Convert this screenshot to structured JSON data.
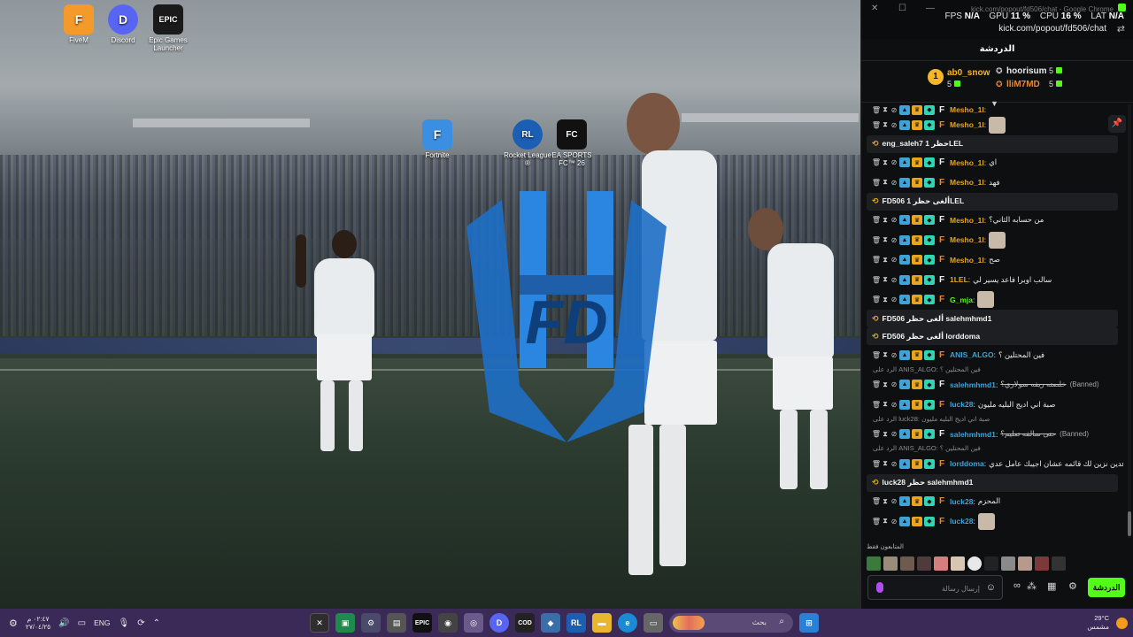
{
  "desktop": {
    "icons": [
      {
        "label": "FiveM",
        "color": "#f39a2a",
        "glyph": "F"
      },
      {
        "label": "Discord",
        "color": "#5865f2",
        "glyph": "D"
      },
      {
        "label": "Epic Games Launcher",
        "color": "#1a1a1a",
        "glyph": "EPIC"
      },
      {
        "label": "Fortnite",
        "color": "#3b8fe2",
        "glyph": "F"
      },
      {
        "label": "Rocket League ®",
        "color": "#1a5fb4",
        "glyph": "RL"
      },
      {
        "label": "EA SPORTS FC™ 26",
        "color": "#111111",
        "glyph": "FC"
      }
    ],
    "wallpaper_logo_text": "FD"
  },
  "chat_window": {
    "title": "kick.com/popout/fd506/chat - Google Chrome",
    "url": "kick.com/popout/fd506/chat",
    "overlay": {
      "fps_label": "FPS",
      "fps": "N/A",
      "gpu_label": "GPU",
      "gpu": "11 %",
      "cpu_label": "CPU",
      "cpu": "16 %",
      "lat_label": "LAT",
      "lat": "N/A"
    },
    "header": "الدردشة",
    "leaderboard": {
      "rank": "1",
      "first": {
        "name": "ab0_snow",
        "count": "5"
      },
      "second": {
        "name": "hoorisum",
        "count": "5"
      },
      "third": {
        "name": "lliM7MD",
        "count": "5"
      }
    },
    "messages": [
      {
        "kind": "msg",
        "user": "Mesho_1l",
        "color": "#e9a51c",
        "text": "",
        "cut": true
      },
      {
        "kind": "msg",
        "user": "Mesho_1l",
        "color": "#e9a51c",
        "text": "",
        "avatar": true
      },
      {
        "kind": "sys",
        "text": "eng_saleh7 حظر 1LEL"
      },
      {
        "kind": "msg",
        "user": "Mesho_1l",
        "color": "#e9a51c",
        "text": "اي"
      },
      {
        "kind": "msg",
        "user": "Mesho_1l",
        "color": "#e9a51c",
        "text": "فهد"
      },
      {
        "kind": "sys",
        "text": "FD506 ألغى حظر 1LEL"
      },
      {
        "kind": "msg",
        "user": "Mesho_1l",
        "color": "#e9a51c",
        "text": "من حسابه الثاني؟"
      },
      {
        "kind": "msg",
        "user": "Mesho_1l",
        "color": "#e9a51c",
        "text": "",
        "avatar": true
      },
      {
        "kind": "msg",
        "user": "Mesho_1l",
        "color": "#e9a51c",
        "text": "صح"
      },
      {
        "kind": "msg",
        "user": "1LEL",
        "color": "#e9a51c",
        "text": "سالب اوبرا فاعد يسير لي"
      },
      {
        "kind": "msg",
        "user": "G_mja",
        "color": "#53fc18",
        "text": "",
        "avatar": true
      },
      {
        "kind": "sys",
        "text": "FD506 ألغى حظر salehmhmd1"
      },
      {
        "kind": "sys",
        "text": "FD506 ألغى حظر lorddoma"
      },
      {
        "kind": "msg",
        "user": "ANIS_ALGO",
        "color": "#3ea3d6",
        "text": "فين المحتلين ؟"
      },
      {
        "kind": "reply",
        "text": "الرد على ANIS_ALGO: فين المحتلين ؟"
      },
      {
        "kind": "msg",
        "user": "salehmhmd1",
        "color": "#3ea3d6",
        "text": "خلصته ريفه سولاري؟",
        "banned": "(Banned)"
      },
      {
        "kind": "msg",
        "user": "luck28",
        "color": "#3ea3d6",
        "text": "صبة اني اديج البليه مليون"
      },
      {
        "kind": "reply",
        "text": "الرد على luck28: صبة اني اديج البليه مليون"
      },
      {
        "kind": "msg",
        "user": "salehmhmd1",
        "color": "#3ea3d6",
        "text": "حتى سالفه تعليم؟",
        "banned": "(Banned)"
      },
      {
        "kind": "reply",
        "text": "الرد على ANIS_ALGO: فين المحتلين ؟"
      },
      {
        "kind": "msg",
        "user": "lorddoma",
        "color": "#3ea3d6",
        "text": "فاعدين نزين لك قائمه عشان اجيبك عامل عدي"
      },
      {
        "kind": "sys",
        "text": "luck28 حظر salehmhmd1"
      },
      {
        "kind": "msg",
        "user": "luck28",
        "color": "#3ea3d6",
        "text": "المحزم"
      },
      {
        "kind": "msg",
        "user": "luck28",
        "color": "#3ea3d6",
        "text": "",
        "avatar": true
      }
    ],
    "subs_label": "المتابعون فقط",
    "input_placeholder": "إرسال رسالة",
    "send_label": "الدردشة"
  },
  "taskbar": {
    "time": "٠٢:٤٧ م",
    "date": "٢٧/٠٤/٢٥",
    "lang": "ENG",
    "search_placeholder": "بحث",
    "weather_temp": "29°C",
    "weather_desc": "مشمس"
  }
}
